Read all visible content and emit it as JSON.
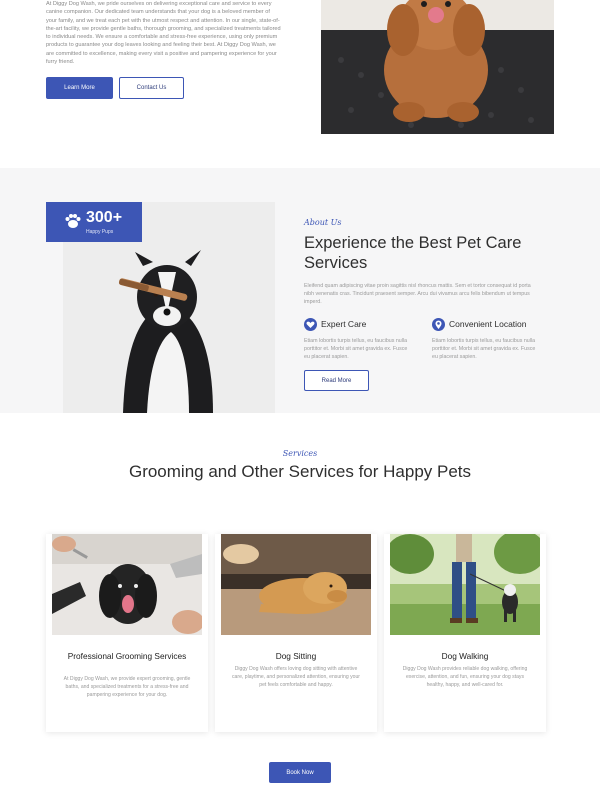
{
  "hero": {
    "paragraph": "At Diggy Dog Wash, we pride ourselves on delivering exceptional care and service to every canine companion. Our dedicated team understands that your dog is a beloved member of your family, and we treat each pet with the utmost respect and attention. In our single, state-of-the-art facility, we provide gentle baths, thorough grooming, and specialized treatments tailored to individual needs. We ensure a comfortable and stress-free experience, using only premium products to guarantee your dog leaves looking and feeling their best. At Diggy Dog Wash, we are committed to excellence, making every visit a positive and pampering experience for your furry friend.",
    "learn_more_label": "Learn More",
    "contact_label": "Contact Us"
  },
  "about": {
    "badge_number": "300+",
    "badge_label": "Happy Pups",
    "eyebrow": "About Us",
    "title": "Experience the Best Pet Care Services",
    "paragraph": "Eleifend quam adipiscing vitae proin sagittis nisl rhoncus mattis. Sem et tortor consequat id porta nibh venenatis cras. Tincidunt praesent semper. Arcu dui vivamus arcu felis bibendum ut tempus imperd.",
    "features": [
      {
        "title": "Expert Care",
        "text": "Etiam lobortis turpis tellus, eu faucibus nulla porttitor et. Morbi sit amet gravida ex. Fusce eu placerat sapien.",
        "icon": "heart-icon"
      },
      {
        "title": "Convenient Location",
        "text": "Etiam lobortis turpis tellus, eu faucibus nulla porttitor et. Morbi sit amet gravida ex. Fusce eu placerat sapien.",
        "icon": "location-pin-icon"
      }
    ],
    "read_more_label": "Read More"
  },
  "services": {
    "eyebrow": "Services",
    "title": "Grooming and Other Services for Happy Pets",
    "cards": [
      {
        "title": "Professional Grooming Services",
        "text": "At Diggy Dog Wash, we provide expert grooming, gentle baths, and specialized treatments for a stress-free and pampering experience for your dog."
      },
      {
        "title": "Dog Sitting",
        "text": "Diggy Dog Wash offers loving dog sitting with attentive care, playtime, and personalized attention, ensuring your pet feels comfortable and happy."
      },
      {
        "title": "Dog Walking",
        "text": "Diggy Dog Wash provides reliable dog walking, offering exercise, attention, and fun, ensuring your dog stays healthy, happy, and well-cared for."
      }
    ],
    "book_label": "Book Now"
  },
  "colors": {
    "accent": "#3d56b5",
    "section_bg": "#f6f6f7",
    "body_text": "#9a9a9a",
    "heading": "#2f2f2f"
  }
}
